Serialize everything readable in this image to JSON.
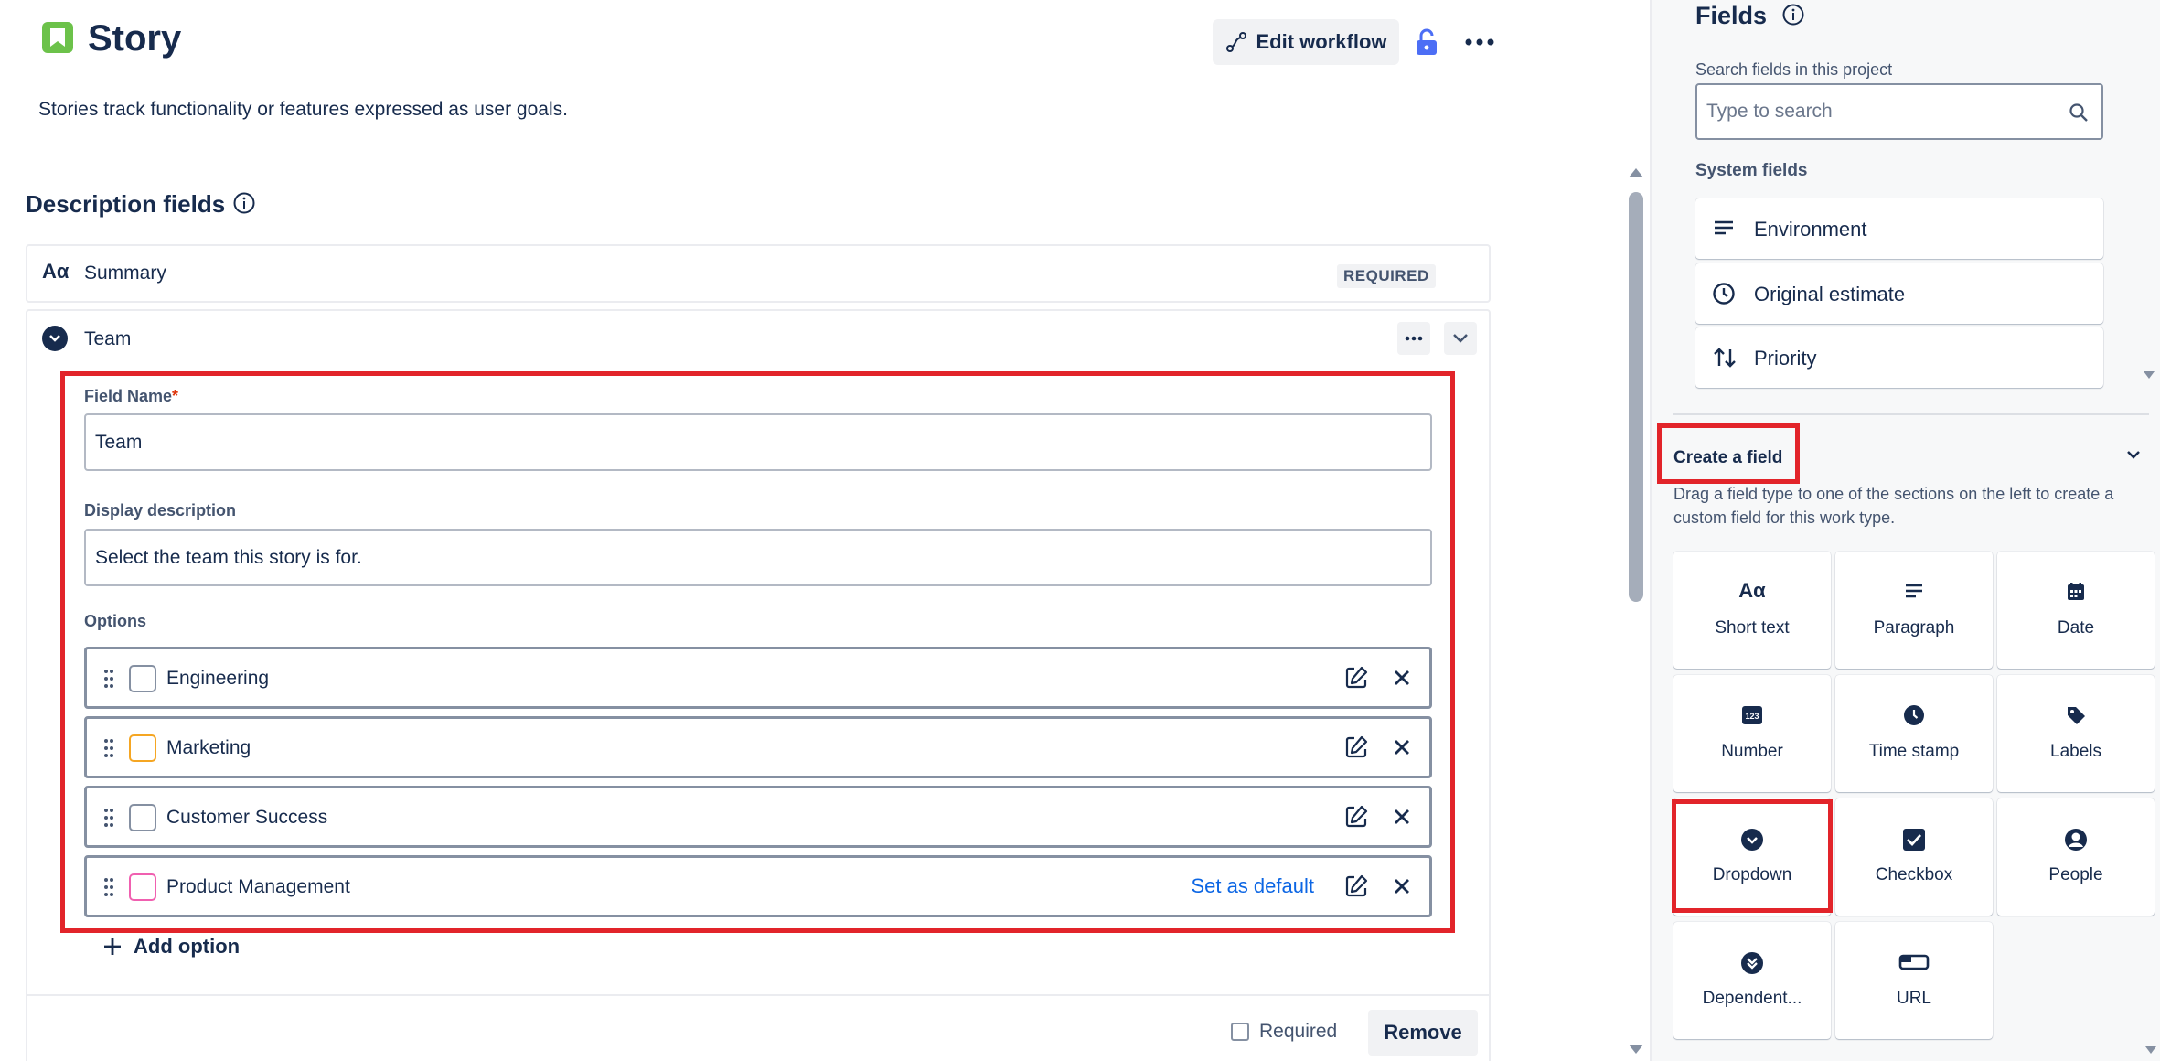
{
  "header": {
    "title": "Story",
    "subtitle": "Stories track functionality or features expressed as user goals.",
    "edit_workflow_label": "Edit workflow"
  },
  "description_fields": {
    "title": "Description fields",
    "summary": {
      "icon_text": "Aα",
      "label": "Summary",
      "badge": "REQUIRED"
    },
    "team": {
      "label": "Team",
      "field_name_label": "Field Name",
      "required_star": "*",
      "field_name_value": "Team",
      "display_description_label": "Display description",
      "display_description_value": "Select the team this story is for.",
      "options_label": "Options",
      "options": [
        {
          "label": "Engineering",
          "color": "#8590a2"
        },
        {
          "label": "Marketing",
          "color": "#f5a623"
        },
        {
          "label": "Customer Success",
          "color": "#8590a2"
        },
        {
          "label": "Product Management",
          "color": "#f060b0",
          "action": "Set as default"
        }
      ],
      "add_option_label": "Add option",
      "required_checkbox_label": "Required",
      "remove_label": "Remove"
    }
  },
  "fields_panel": {
    "title": "Fields",
    "search_label": "Search fields in this project",
    "search_placeholder": "Type to search",
    "system_fields_label": "System fields",
    "system_fields": [
      {
        "label": "Environment",
        "icon": "paragraph-lines-icon"
      },
      {
        "label": "Original estimate",
        "icon": "clock-icon"
      },
      {
        "label": "Priority",
        "icon": "sort-arrows-icon"
      }
    ],
    "create_field": {
      "title": "Create a field",
      "description": "Drag a field type to one of the sections on the left to create a custom field for this work type.",
      "types": [
        {
          "label": "Short text",
          "icon": "short-text-icon"
        },
        {
          "label": "Paragraph",
          "icon": "paragraph-icon"
        },
        {
          "label": "Date",
          "icon": "calendar-icon"
        },
        {
          "label": "Number",
          "icon": "number-icon"
        },
        {
          "label": "Time stamp",
          "icon": "clock-icon"
        },
        {
          "label": "Labels",
          "icon": "tag-icon"
        },
        {
          "label": "Dropdown",
          "icon": "dropdown-icon"
        },
        {
          "label": "Checkbox",
          "icon": "checkbox-icon"
        },
        {
          "label": "People",
          "icon": "person-icon"
        },
        {
          "label": "Dependent...",
          "icon": "dependent-dropdown-icon"
        },
        {
          "label": "URL",
          "icon": "link-icon"
        }
      ]
    }
  },
  "colors": {
    "story_icon": "#6cc24a",
    "accent_link": "#0c66e4",
    "highlight": "#e2242a",
    "lock_icon": "#4c6ef5"
  }
}
